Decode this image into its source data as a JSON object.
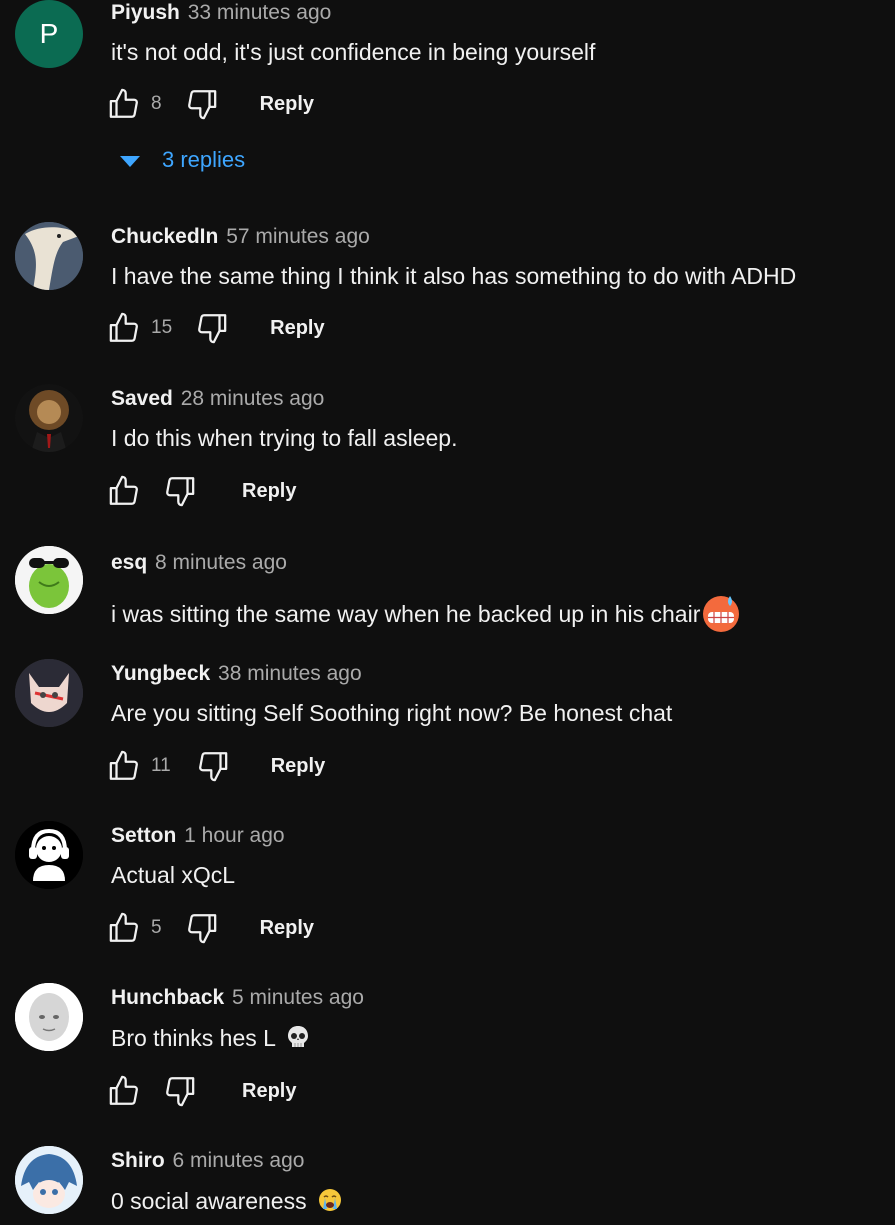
{
  "colors": {
    "background": "#0f0f0f",
    "text": "#f1f1f1",
    "secondary": "#aaaaaa",
    "link": "#3ea6ff"
  },
  "comments": [
    {
      "author": "Piyush",
      "time": "33 minutes ago",
      "text": "it's not odd, it's just confidence in being yourself",
      "likes": "8",
      "reply_label": "Reply",
      "avatar": {
        "type": "letter",
        "letter": "P",
        "color": "#0b6b52"
      },
      "replies_label": "3 replies"
    },
    {
      "author": "ChuckedIn",
      "time": "57 minutes ago",
      "text": "I have the same thing I think it also has something to do with ADHD",
      "likes": "15",
      "reply_label": "Reply",
      "avatar": {
        "type": "image",
        "name": "goose-avatar"
      }
    },
    {
      "author": "Saved",
      "time": "28 minutes ago",
      "text": "I do this when trying to fall asleep.",
      "likes": "",
      "reply_label": "Reply",
      "avatar": {
        "type": "image",
        "name": "lion-suit-avatar"
      }
    },
    {
      "author": "esq",
      "time": "8 minutes ago",
      "text": "i was sitting the same way when he backed up in his chair",
      "emoji": "grimacing-sweat-emoji",
      "avatar": {
        "type": "image",
        "name": "frog-sunglasses-avatar"
      }
    },
    {
      "author": "Yungbeck",
      "time": "38 minutes ago",
      "text": "Are you sitting Self Soothing right now? Be honest chat",
      "likes": "11",
      "reply_label": "Reply",
      "avatar": {
        "type": "image",
        "name": "cat-avatar"
      }
    },
    {
      "author": "Setton",
      "time": "1 hour ago",
      "text": "Actual xQcL",
      "likes": "5",
      "reply_label": "Reply",
      "avatar": {
        "type": "image",
        "name": "headphones-avatar"
      }
    },
    {
      "author": "Hunchback",
      "time": "5 minutes ago",
      "text": "Bro thinks hes L",
      "emoji": "skull-emoji",
      "likes": "",
      "reply_label": "Reply",
      "avatar": {
        "type": "image",
        "name": "bald-head-avatar"
      }
    },
    {
      "author": "Shiro",
      "time": "6 minutes ago",
      "text": "0 social awareness",
      "emoji": "crying-emoji",
      "avatar": {
        "type": "image",
        "name": "anime-shark-avatar"
      }
    }
  ]
}
